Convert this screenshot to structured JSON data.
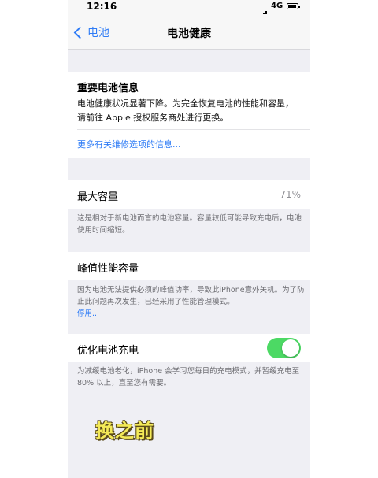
{
  "status_bar": {
    "time": "12:16",
    "network": "4G"
  },
  "nav": {
    "back_label": "电池",
    "title": "电池健康"
  },
  "important_info": {
    "title": "重要电池信息",
    "body": "电池健康状况显著下降。为完全恢复电池的性能和容量，请前往 Apple 授权服务商处进行更换。",
    "link": "更多有关维修选项的信息..."
  },
  "max_capacity": {
    "label": "最大容量",
    "value": "71%",
    "footer": "这是相对于新电池而言的电池容量。容量较低可能导致充电后，电池使用时间缩短。"
  },
  "peak_performance": {
    "label": "峰值性能容量",
    "footer": "因为电池无法提供必须的峰值功率，导致此iPhone意外关机。为了防止此问题再次发生，已经采用了性能管理模式。",
    "footer_link": "停用..."
  },
  "optimized_charging": {
    "label": "优化电池充电",
    "enabled": true,
    "footer": "为减缓电池老化，iPhone 会学习您每日的充电模式，并暂缓充电至 80% 以上，直至您有需要。"
  },
  "overlay_caption": "换之前",
  "colors": {
    "accent": "#2f7cf6",
    "toggle_on": "#4cd964",
    "caption": "#f4ea58"
  }
}
